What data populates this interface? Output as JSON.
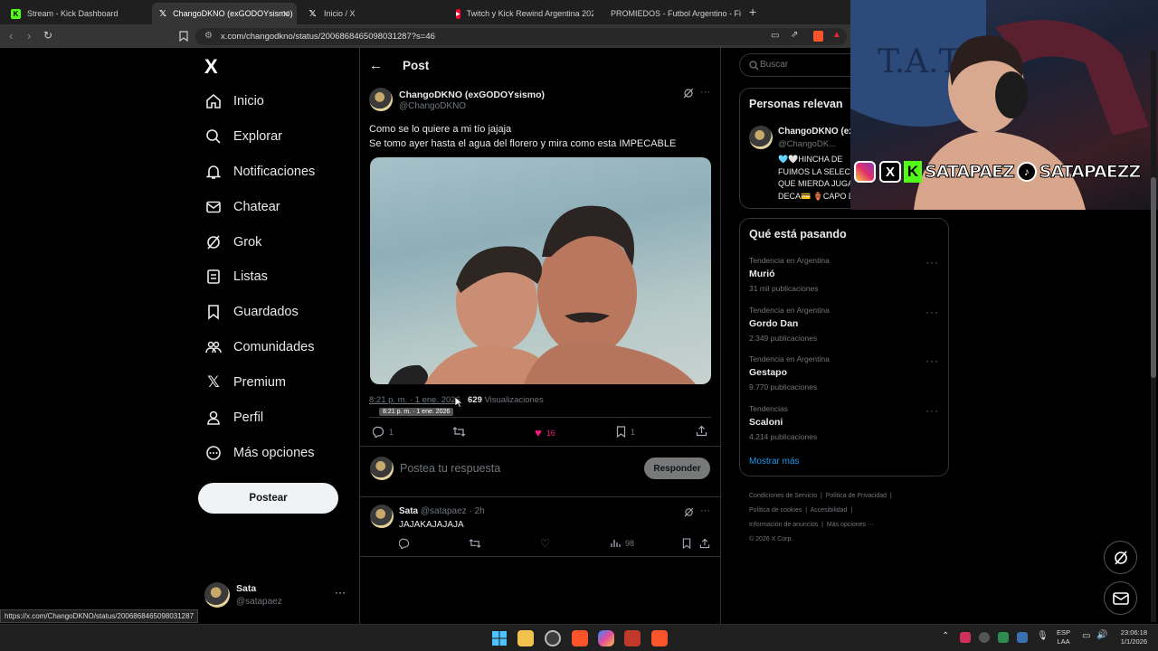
{
  "browser": {
    "tabs": [
      {
        "title": "Stream - Kick Dashboard",
        "icon": "kick-icon",
        "color": "#53fc18"
      },
      {
        "title": "ChangoDKNO (exGODOYsismo)",
        "icon": "x-logo-icon",
        "color": "#ffffff"
      },
      {
        "title": "Inicio / X",
        "icon": "x-logo-icon",
        "color": "#ffffff"
      },
      {
        "title": "Twitch y Kick Rewind Argentina 2025",
        "icon": "youtube-icon",
        "color": "#ff0033"
      },
      {
        "title": "PROMIEDOS - Futbol Argentino - Fi",
        "icon": "promiedos-icon",
        "color": "#2ea043"
      }
    ],
    "new_tab": "+",
    "url": "x.com/changodkno/status/2006868465098031287?s=46",
    "status_url": "https://x.com/ChangoDKNO/status/2006868465098031287"
  },
  "sidebar": {
    "logo": "X",
    "items": [
      {
        "label": "Inicio",
        "icon": "home-icon"
      },
      {
        "label": "Explorar",
        "icon": "search-icon"
      },
      {
        "label": "Notificaciones",
        "icon": "bell-icon"
      },
      {
        "label": "Chatear",
        "icon": "mail-icon"
      },
      {
        "label": "Grok",
        "icon": "grok-icon"
      },
      {
        "label": "Listas",
        "icon": "list-icon"
      },
      {
        "label": "Guardados",
        "icon": "bookmark-icon"
      },
      {
        "label": "Comunidades",
        "icon": "communities-icon"
      },
      {
        "label": "Premium",
        "icon": "x-logo-icon"
      },
      {
        "label": "Perfil",
        "icon": "person-icon"
      },
      {
        "label": "Más opciones",
        "icon": "more-circle-icon"
      }
    ],
    "post_button": "Postear",
    "account": {
      "name": "Sata",
      "handle": "@satapaez",
      "menu": "···"
    }
  },
  "post": {
    "header_title": "Post",
    "author_name": "ChangoDKNO (exGODOYsismo)",
    "author_handle": "@ChangoDKNO",
    "text_line1": "Como se lo quiere a mi tío jajaja",
    "text_line2": "Se tomo ayer hasta el agua del florero y mira como esta IMPECABLE",
    "timestamp": "8:21 p. m. · 1 ene. 2026",
    "tooltip": "8:21 p. m. · 1 ene. 2026",
    "views_count": "629",
    "views_label": "Visualizaciones",
    "replies": "1",
    "reposts": "",
    "likes": "16",
    "bookmarks": "1",
    "like_color": "#f91880"
  },
  "reply_composer": {
    "placeholder": "Postea tu respuesta",
    "button": "Responder"
  },
  "reply": {
    "author_name": "Sata",
    "author_handle": "@satapaez",
    "time": "· 2h",
    "text": "JAJAKAJAJAJA",
    "views": "98"
  },
  "right": {
    "search_placeholder": "Buscar",
    "relevant_title": "Personas relevan",
    "relevant_person": {
      "name": "ChangoDKNO (ex",
      "handle": "@ChangoDK...",
      "bio_line1": "🩵🤍HINCHA DE",
      "bio_line2": "FUIMOS LA SELEC",
      "bio_line3": "QUE MIERDA JUGA",
      "bio_line4": "DECA💳 🏺CAPO DE LA PLATEA🏺"
    },
    "trends_title": "Qué está pasando",
    "trends": [
      {
        "meta": "Tendencia en Argentina",
        "name": "Murió",
        "count": "31 mil publicaciones"
      },
      {
        "meta": "Tendencia en Argentina",
        "name": "Gordo Dan",
        "count": "2.349 publicaciones"
      },
      {
        "meta": "Tendencia en Argentina",
        "name": "Gestapo",
        "count": "9.770 publicaciones"
      },
      {
        "meta": "Tendencias",
        "name": "Scaloni",
        "count": "4.214 publicaciones"
      }
    ],
    "show_more": "Mostrar más",
    "footer": {
      "terms": "Condiciones de Servicio",
      "privacy": "Política de Privacidad",
      "cookies": "Política de cookies",
      "accessibility": "Accesibilidad",
      "ads": "Información de anuncios",
      "more": "Más opciones ···",
      "copyright": "© 2026 X Corp."
    }
  },
  "overlay": {
    "social_handle_1": "SATAPAEZ",
    "social_handle_2": "SATAPAEZZ"
  },
  "taskbar": {
    "lang": "ESP",
    "lang2": "LAA",
    "time": "23:06:18",
    "date": "1/1/2026"
  }
}
